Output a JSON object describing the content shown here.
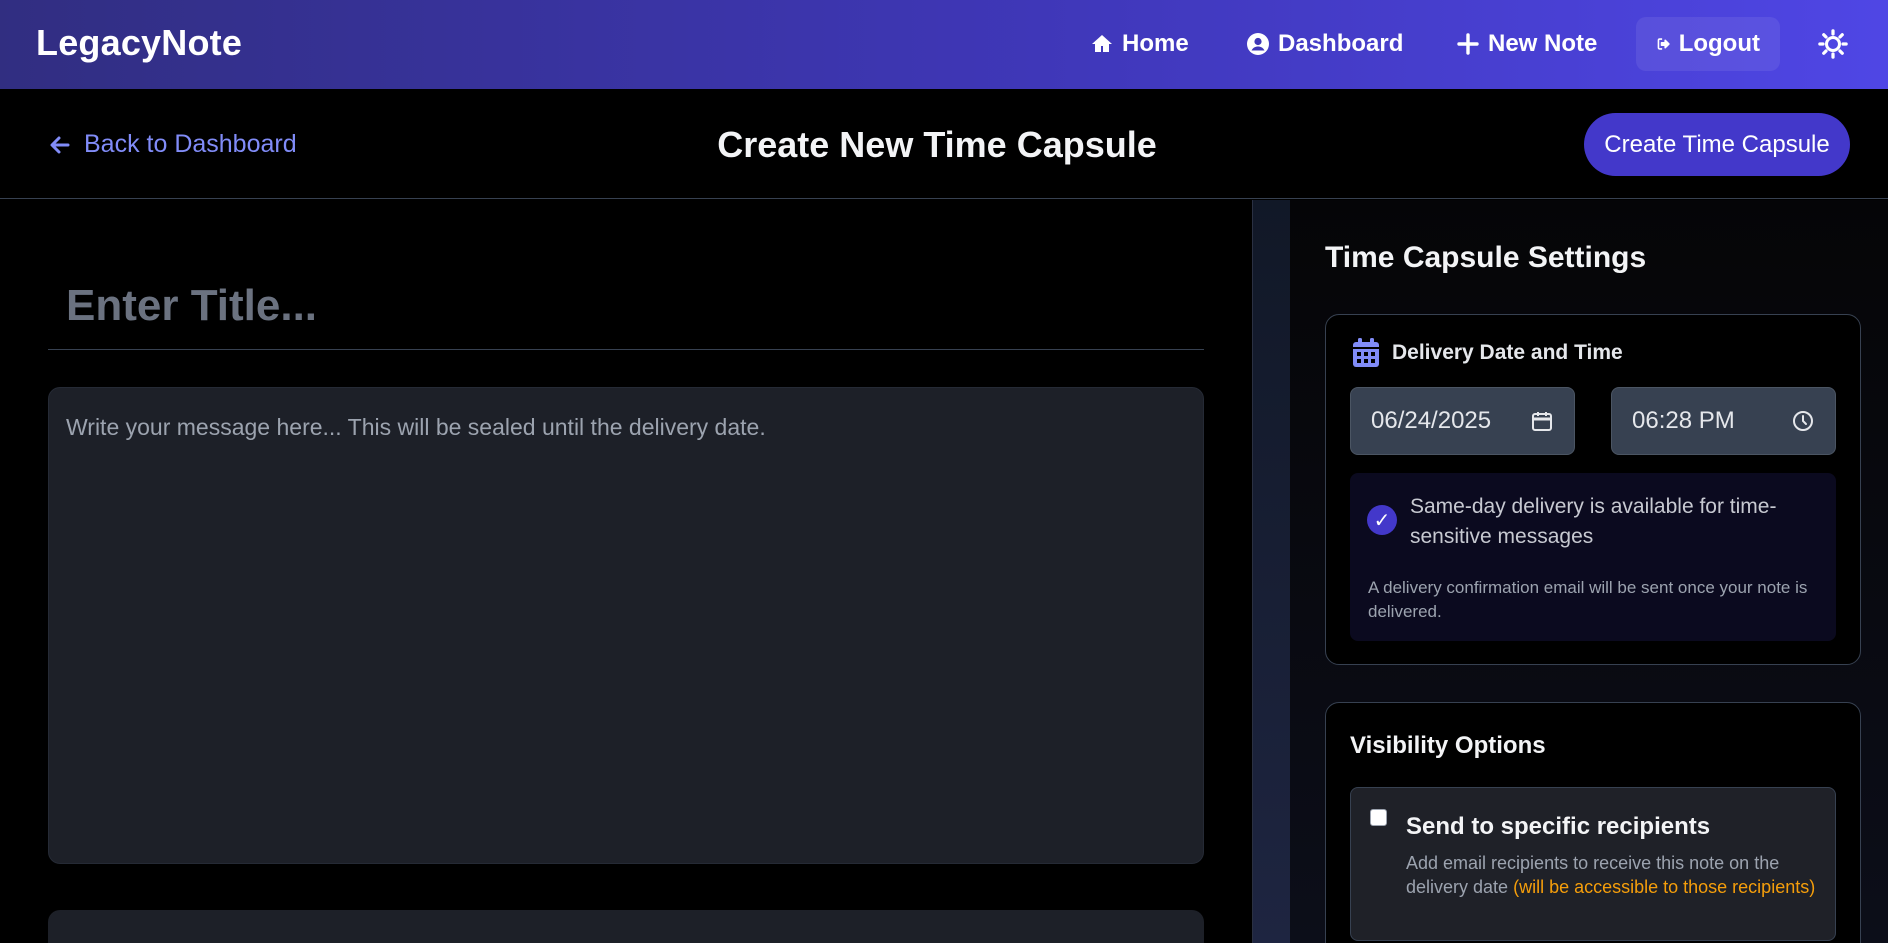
{
  "nav": {
    "brand": "LegacyNote",
    "home": "Home",
    "dashboard": "Dashboard",
    "new_note": "New Note",
    "logout": "Logout"
  },
  "subheader": {
    "back": "Back to Dashboard",
    "title": "Create New Time Capsule",
    "create_button": "Create Time Capsule"
  },
  "editor": {
    "title_placeholder": "Enter Title...",
    "message_placeholder": "Write your message here... This will be sealed until the delivery date."
  },
  "settings": {
    "title": "Time Capsule Settings",
    "delivery": {
      "label": "Delivery Date and Time",
      "date": "06/24/2025",
      "time": "06:28 PM",
      "info_main": "Same-day delivery is available for time-sensitive messages",
      "info_sub": "A delivery confirmation email will be sent once your note is delivered."
    },
    "visibility": {
      "title": "Visibility Options",
      "recipients_label": "Send to specific recipients",
      "recipients_desc": "Add email recipients to receive this note on the delivery date",
      "recipients_note": "(will be accessible to those recipients)"
    }
  },
  "colors": {
    "accent": "#4338ca",
    "link": "#818cf8",
    "warning": "#f59e0b"
  },
  "icons": {
    "home": "home-icon",
    "dashboard": "user-circle-icon",
    "new_note": "plus-icon",
    "logout": "logout-icon",
    "theme": "sun-icon",
    "back": "arrow-left-icon",
    "calendar": "calendar-icon",
    "clock": "clock-icon",
    "check": "check-icon"
  }
}
